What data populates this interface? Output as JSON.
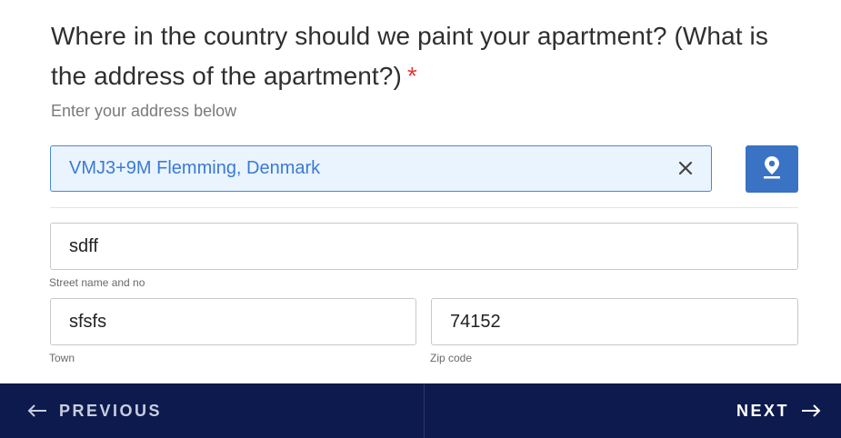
{
  "question": {
    "text": "Where in the country should we paint your apartment? (What is the address of the apartment?)",
    "required_marker": "*",
    "hint": "Enter your address below"
  },
  "address_search": {
    "value": "VMJ3+9M Flemming, Denmark",
    "clear_icon": "close-icon",
    "locate_icon": "map-pin-icon"
  },
  "fields": {
    "street": {
      "value": "sdff",
      "label": "Street name and no"
    },
    "town": {
      "value": "sfsfs",
      "label": "Town"
    },
    "zip": {
      "value": "74152",
      "label": "Zip code"
    }
  },
  "footer": {
    "previous_label": "PREVIOUS",
    "next_label": "NEXT",
    "previous_icon": "arrow-left-icon",
    "next_icon": "arrow-right-icon"
  },
  "colors": {
    "accent": "#3a72c4",
    "footer_bg": "#0d1a4d",
    "required": "#e53935",
    "address_bg": "#eaf4ff",
    "address_text": "#3b7ad4"
  }
}
